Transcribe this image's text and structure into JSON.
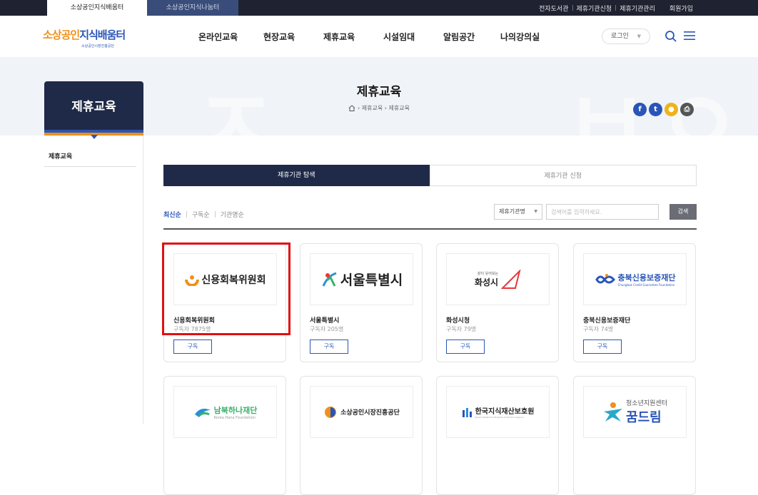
{
  "topbar": {
    "tab_active": "소상공인지식배움터",
    "tab_inactive": "소상공인지식나눔터",
    "links": [
      "전자도서관",
      "제휴기관신청",
      "제휴기관관리",
      "회원가입"
    ]
  },
  "header": {
    "logo_orange": "소상공인",
    "logo_blue": "지식배움터",
    "logo_sub": "소상공인시장진흥공단",
    "nav": [
      "온라인교육",
      "현장교육",
      "제휴교육",
      "시설임대",
      "알림공간",
      "나의강의실"
    ],
    "login": "로그인"
  },
  "banner": {
    "side_title": "제휴교육",
    "page_title": "제휴교육",
    "breadcrumb": "› 제휴교육 › 제휴교육"
  },
  "sidebar": {
    "items": [
      "제휴교육"
    ]
  },
  "tabs": [
    "제휴기관 탐색",
    "제휴기관 신청"
  ],
  "sort": [
    "최신순",
    "구독순",
    "기관명순"
  ],
  "search": {
    "select": "제휴기관명",
    "placeholder": "검색어를 입력하세요.",
    "button": "검색"
  },
  "cards": [
    {
      "name": "신용회복위원회",
      "subs": "구독자 7875명",
      "button": "구독",
      "logo_text": "신용회복위원회"
    },
    {
      "name": "서울특별시",
      "subs": "구독자 205명",
      "button": "구독",
      "logo_text": "서울특별시"
    },
    {
      "name": "화성시청",
      "subs": "구독자 79명",
      "button": "구독",
      "logo_text": "화성시",
      "logo_small": "같이 웃어보는"
    },
    {
      "name": "충북신용보증재단",
      "subs": "구독자 74명",
      "button": "구독",
      "logo_text": "충북신용보증재단",
      "logo_small": "Chungbuk Credit Guarantee Foundation"
    },
    {
      "logo_text": "남북하나재단",
      "logo_small": "Korea Hana Foundation"
    },
    {
      "logo_text": "소상공인시장진흥공단"
    },
    {
      "logo_text": "한국지식재산보호원",
      "logo_small": "Korea Intellectual Property Protection Agency"
    },
    {
      "logo_text": "꿈드림",
      "logo_small": "청소년지원센터"
    }
  ],
  "colors": {
    "navy": "#1f2a48",
    "brand_blue": "#2a55b7",
    "brand_orange": "#f0901a",
    "highlight": "#e01010"
  }
}
